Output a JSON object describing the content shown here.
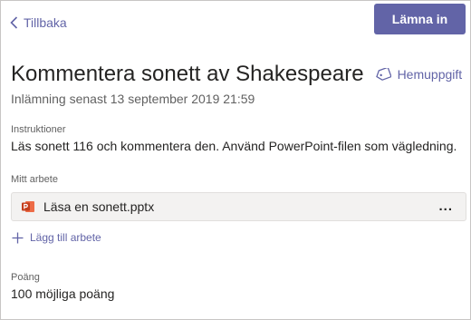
{
  "header": {
    "back_label": "Tillbaka",
    "submit_label": "Lämna in"
  },
  "assignment": {
    "title": "Kommentera sonett av Shakespeare",
    "category": "Hemuppgift",
    "deadline": "Inlämning senast 13 september 2019 21:59"
  },
  "instructions": {
    "label": "Instruktioner",
    "text": "Läs sonett 116 och kommentera den. Använd PowerPoint-filen som vägledning."
  },
  "my_work": {
    "label": "Mitt arbete",
    "files": [
      {
        "name": "Läsa en sonett.pptx",
        "icon": "powerpoint-icon"
      }
    ],
    "more_label": "...",
    "add_label": "Lägg till arbete"
  },
  "points": {
    "label": "Poäng",
    "value": "100 möjliga poäng"
  },
  "colors": {
    "accent": "#6264a7",
    "powerpoint": "#c43e1c",
    "text": "#252423",
    "secondary_text": "#616161"
  }
}
